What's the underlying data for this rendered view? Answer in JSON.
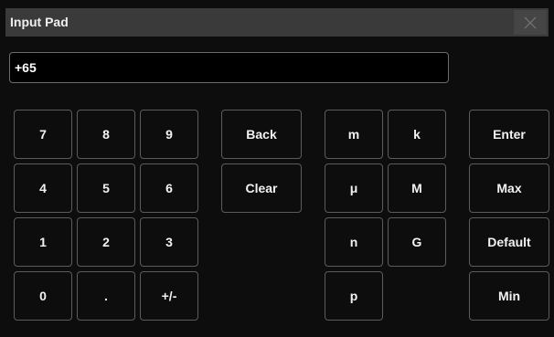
{
  "window": {
    "title": "Input Pad",
    "close_icon": "close-icon"
  },
  "input": {
    "value": "+65"
  },
  "keys": {
    "num_7": "7",
    "num_8": "8",
    "num_9": "9",
    "num_4": "4",
    "num_5": "5",
    "num_6": "6",
    "num_1": "1",
    "num_2": "2",
    "num_3": "3",
    "num_0": "0",
    "dot": ".",
    "sign": "+/-",
    "back": "Back",
    "clear": "Clear",
    "milli": "m",
    "kilo": "k",
    "micro": "μ",
    "mega": "M",
    "nano": "n",
    "giga": "G",
    "pico": "p",
    "enter": "Enter",
    "max": "Max",
    "default": "Default",
    "min": "Min"
  }
}
